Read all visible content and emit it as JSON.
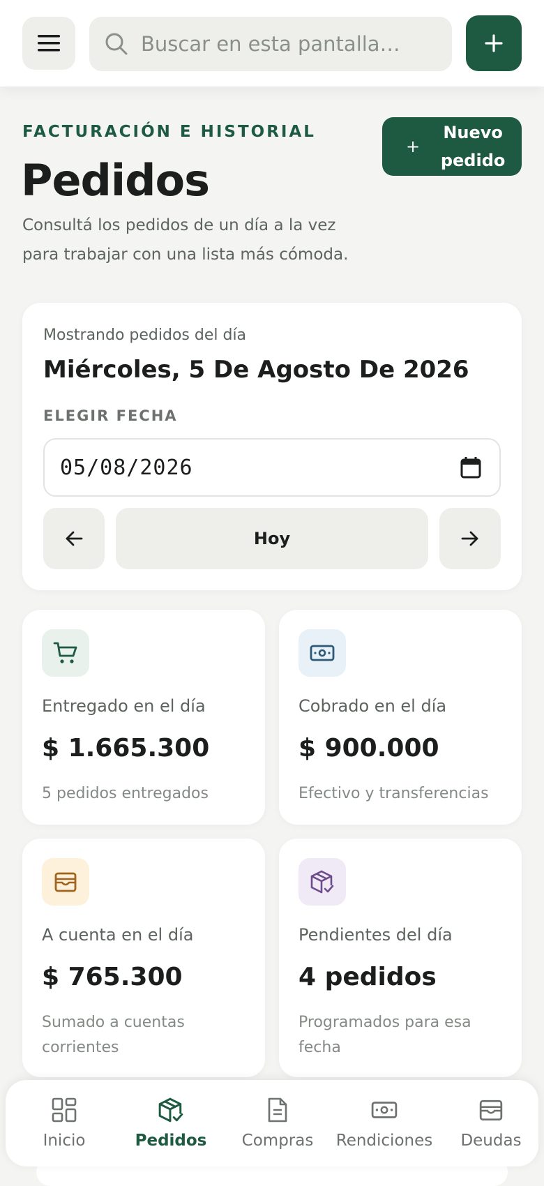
{
  "topbar": {
    "search_placeholder": "Buscar en esta pantalla…"
  },
  "header": {
    "eyebrow": "FACTURACIÓN E HISTORIAL",
    "title": "Pedidos",
    "subtitle": "Consultá los pedidos de un día a la vez para trabajar con una lista más cómoda.",
    "new_order_label": "Nuevo pedido"
  },
  "date_card": {
    "showing_label": "Mostrando pedidos del día",
    "date_heading": "Miércoles, 5 De Agosto De 2026",
    "choose_label": "ELEGIR FECHA",
    "date_value": "05/08/2026",
    "today_label": "Hoy"
  },
  "stats": [
    {
      "icon": "cart-icon",
      "label": "Entregado en el día",
      "value": "$ 1.665.300",
      "sub": "5 pedidos entregados",
      "icon_color": "#1e5a41",
      "icon_bg": "#e8f1ec"
    },
    {
      "icon": "cash-icon",
      "label": "Cobrado en el día",
      "value": "$ 900.000",
      "sub": "Efectivo y transferencias",
      "icon_color": "#2d5877",
      "icon_bg": "#e9f1f8"
    },
    {
      "icon": "wallet-icon",
      "label": "A cuenta en el día",
      "value": "$ 765.300",
      "sub": "Sumado a cuentas corrientes",
      "icon_color": "#a0651c",
      "icon_bg": "#fdf1dc"
    },
    {
      "icon": "package-check-icon",
      "label": "Pendientes del día",
      "value": "4 pedidos",
      "sub": "Programados para esa fecha",
      "icon_color": "#6d4c8c",
      "icon_bg": "#f0e9f6"
    }
  ],
  "bottom_nav": [
    {
      "label": "Inicio",
      "icon": "grid-icon"
    },
    {
      "label": "Pedidos",
      "icon": "package-check-icon",
      "active": true
    },
    {
      "label": "Compras",
      "icon": "document-icon"
    },
    {
      "label": "Rendiciones",
      "icon": "cash-icon"
    },
    {
      "label": "Deudas",
      "icon": "wallet-icon"
    }
  ],
  "colors": {
    "brand": "#1e5a41",
    "background": "#f4f4f2"
  }
}
